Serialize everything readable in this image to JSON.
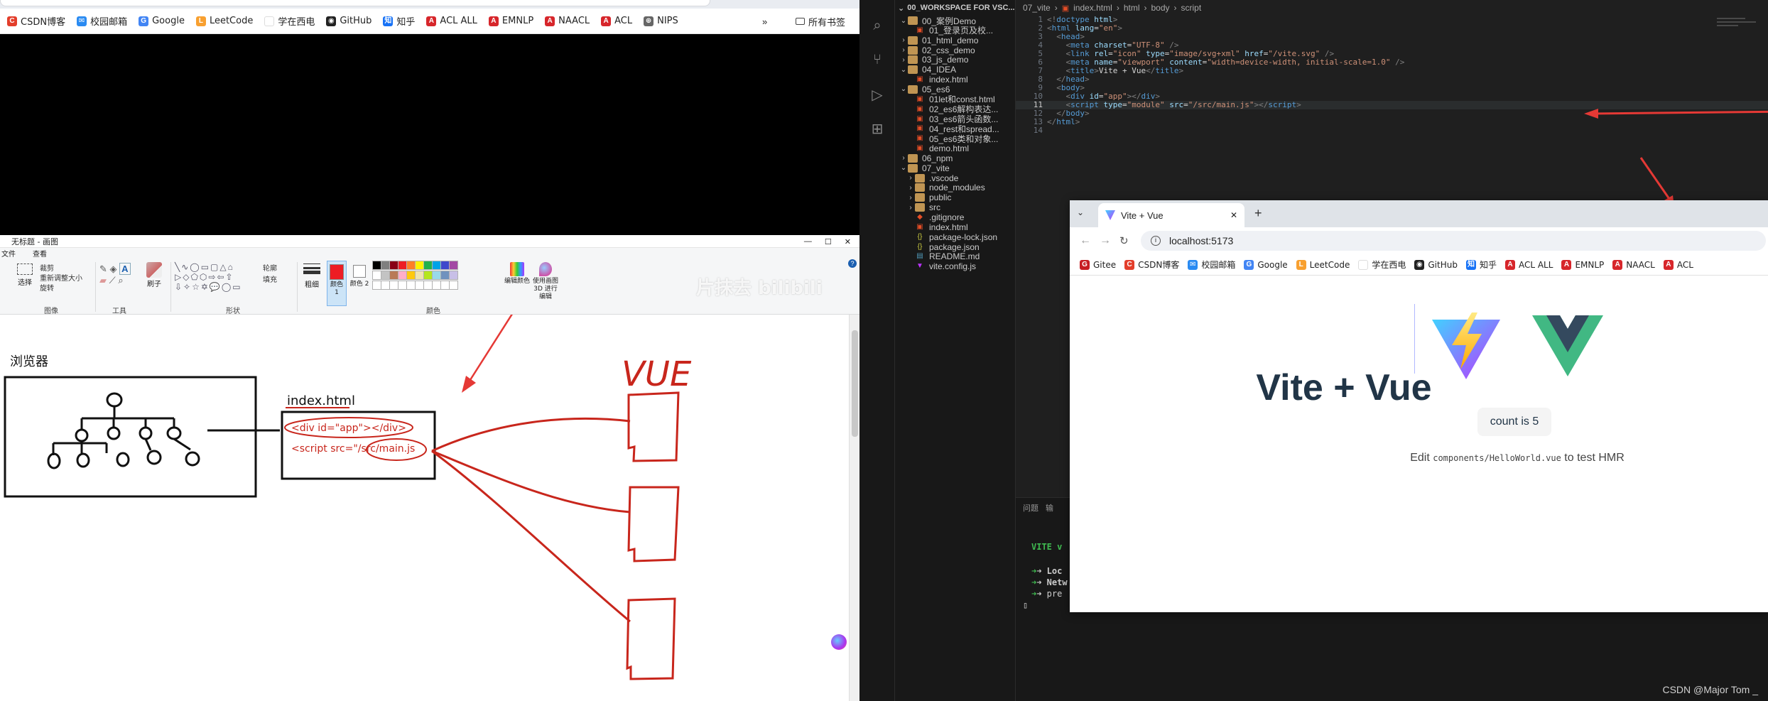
{
  "left_browser": {
    "bookmarks": [
      {
        "label": "CSDN博客",
        "color": "#e33e2b",
        "glyph": "C"
      },
      {
        "label": "校园邮箱",
        "color": "#2a8bf2",
        "glyph": "✉"
      },
      {
        "label": "Google",
        "color": "#4285f4",
        "glyph": "G"
      },
      {
        "label": "LeetCode",
        "color": "#f8a030",
        "glyph": "L"
      },
      {
        "label": "学在西电",
        "color": "#ffffff",
        "glyph": ""
      },
      {
        "label": "GitHub",
        "color": "#222222",
        "glyph": "◉"
      },
      {
        "label": "知乎",
        "color": "#1772f6",
        "glyph": "知"
      },
      {
        "label": "ACL ALL",
        "color": "#d7262b",
        "glyph": "A"
      },
      {
        "label": "EMNLP",
        "color": "#d7262b",
        "glyph": "A"
      },
      {
        "label": "NAACL",
        "color": "#d7262b",
        "glyph": "A"
      },
      {
        "label": "ACL",
        "color": "#d7262b",
        "glyph": "A"
      },
      {
        "label": "NIPS",
        "color": "#666666",
        "glyph": "⊕"
      }
    ],
    "more_label": "»",
    "all_bookmarks_label": "所有书签"
  },
  "paint": {
    "title": "无标题 - 画图",
    "tabs": [
      "文件",
      "查看"
    ],
    "groups": [
      "图像",
      "工具",
      "形状",
      "颜色"
    ],
    "image_tools": [
      "裁剪",
      "重新调整大小",
      "旋转"
    ],
    "select_label": "选择",
    "brush_label": "刷子",
    "outline_label": "轮廓",
    "fill_label": "填充",
    "size_label": "粗细",
    "color1_label": "颜色 1",
    "color2_label": "颜色 2",
    "edit_colors_label": "编辑颜色",
    "paint3d_label": "使用画图 3D 进行编辑",
    "palette": [
      "#000000",
      "#7f7f7f",
      "#880015",
      "#ed1c24",
      "#ff7f27",
      "#fff200",
      "#22b14c",
      "#00a2e8",
      "#3f48cc",
      "#a349a4",
      "#ffffff",
      "#c3c3c3",
      "#b97a57",
      "#ffaec9",
      "#ffc90e",
      "#efe4b0",
      "#b5e61d",
      "#99d9ea",
      "#7092be",
      "#c8bfe7"
    ],
    "active_color": "#ed1c24",
    "overlay_watermark": "片抹去 bilibili",
    "canvas": {
      "browser_label": "浏览器",
      "file_label": "index.html",
      "line1": "<div id=\"app\"></div>",
      "line2": "<script src=\"/src/main.js",
      "vue_label": "VUE",
      "ink_color": "#c8261c"
    }
  },
  "vscode": {
    "explorer_title": "00_WORKSPACE FOR VSC...",
    "tree": [
      {
        "label": "00_案例Demo",
        "type": "folder",
        "open": true,
        "depth": 0
      },
      {
        "label": "01_登录页及校...",
        "type": "html",
        "depth": 1
      },
      {
        "label": "01_html_demo",
        "type": "folder",
        "open": false,
        "depth": 0
      },
      {
        "label": "02_css_demo",
        "type": "folder",
        "open": false,
        "depth": 0
      },
      {
        "label": "03_js_demo",
        "type": "folder",
        "open": false,
        "depth": 0
      },
      {
        "label": "04_IDEA",
        "type": "folder",
        "open": true,
        "depth": 0
      },
      {
        "label": "index.html",
        "type": "html",
        "depth": 1
      },
      {
        "label": "05_es6",
        "type": "folder",
        "open": true,
        "depth": 0
      },
      {
        "label": "01let和const.html",
        "type": "html",
        "depth": 1
      },
      {
        "label": "02_es6解构表达...",
        "type": "html",
        "depth": 1
      },
      {
        "label": "03_es6箭头函数...",
        "type": "html",
        "depth": 1
      },
      {
        "label": "04_rest和spread...",
        "type": "html",
        "depth": 1
      },
      {
        "label": "05_es6类和对象...",
        "type": "html",
        "depth": 1
      },
      {
        "label": "demo.html",
        "type": "html",
        "depth": 1
      },
      {
        "label": "06_npm",
        "type": "folder",
        "open": false,
        "depth": 0
      },
      {
        "label": "07_vite",
        "type": "folder",
        "open": true,
        "depth": 0
      },
      {
        "label": ".vscode",
        "type": "folder",
        "open": false,
        "depth": 1
      },
      {
        "label": "node_modules",
        "type": "folder",
        "open": false,
        "depth": 1
      },
      {
        "label": "public",
        "type": "folder",
        "open": false,
        "depth": 1
      },
      {
        "label": "src",
        "type": "folder",
        "open": false,
        "depth": 1
      },
      {
        "label": ".gitignore",
        "type": "git",
        "depth": 1
      },
      {
        "label": "index.html",
        "type": "html",
        "depth": 1
      },
      {
        "label": "package-lock.json",
        "type": "json",
        "depth": 1
      },
      {
        "label": "package.json",
        "type": "json",
        "depth": 1
      },
      {
        "label": "README.md",
        "type": "md",
        "depth": 1
      },
      {
        "label": "vite.config.js",
        "type": "vite",
        "depth": 1
      }
    ],
    "breadcrumbs": [
      "07_vite",
      "index.html",
      "html",
      "body",
      "script"
    ],
    "code_lines": [
      {
        "n": "1",
        "tokens": [
          [
            "t-punc",
            "<!"
          ],
          [
            "t-tag",
            "doctype"
          ],
          [
            "t-text",
            " "
          ],
          [
            "t-attr",
            "html"
          ],
          [
            "t-punc",
            ">"
          ]
        ]
      },
      {
        "n": "2",
        "tokens": [
          [
            "t-punc",
            "<"
          ],
          [
            "t-tag",
            "html"
          ],
          [
            "t-text",
            " "
          ],
          [
            "t-attr",
            "lang"
          ],
          [
            "t-text",
            "="
          ],
          [
            "t-str",
            "\"en\""
          ],
          [
            "t-punc",
            ">"
          ]
        ]
      },
      {
        "n": "3",
        "tokens": [
          [
            "t-text",
            "  "
          ],
          [
            "t-punc",
            "<"
          ],
          [
            "t-tag",
            "head"
          ],
          [
            "t-punc",
            ">"
          ]
        ]
      },
      {
        "n": "4",
        "tokens": [
          [
            "t-text",
            "    "
          ],
          [
            "t-punc",
            "<"
          ],
          [
            "t-tag",
            "meta"
          ],
          [
            "t-text",
            " "
          ],
          [
            "t-attr",
            "charset"
          ],
          [
            "t-text",
            "="
          ],
          [
            "t-str",
            "\"UTF-8\""
          ],
          [
            "t-text",
            " "
          ],
          [
            "t-punc",
            "/>"
          ]
        ]
      },
      {
        "n": "5",
        "tokens": [
          [
            "t-text",
            "    "
          ],
          [
            "t-punc",
            "<"
          ],
          [
            "t-tag",
            "link"
          ],
          [
            "t-text",
            " "
          ],
          [
            "t-attr",
            "rel"
          ],
          [
            "t-text",
            "="
          ],
          [
            "t-str",
            "\"icon\""
          ],
          [
            "t-text",
            " "
          ],
          [
            "t-attr",
            "type"
          ],
          [
            "t-text",
            "="
          ],
          [
            "t-str",
            "\"image/svg+xml\""
          ],
          [
            "t-text",
            " "
          ],
          [
            "t-attr",
            "href"
          ],
          [
            "t-text",
            "="
          ],
          [
            "t-str",
            "\"/vite.svg\""
          ],
          [
            "t-text",
            " "
          ],
          [
            "t-punc",
            "/>"
          ]
        ]
      },
      {
        "n": "6",
        "tokens": [
          [
            "t-text",
            "    "
          ],
          [
            "t-punc",
            "<"
          ],
          [
            "t-tag",
            "meta"
          ],
          [
            "t-text",
            " "
          ],
          [
            "t-attr",
            "name"
          ],
          [
            "t-text",
            "="
          ],
          [
            "t-str",
            "\"viewport\""
          ],
          [
            "t-text",
            " "
          ],
          [
            "t-attr",
            "content"
          ],
          [
            "t-text",
            "="
          ],
          [
            "t-str",
            "\"width=device-width, initial-scale=1.0\""
          ],
          [
            "t-text",
            " "
          ],
          [
            "t-punc",
            "/>"
          ]
        ]
      },
      {
        "n": "7",
        "tokens": [
          [
            "t-text",
            "    "
          ],
          [
            "t-punc",
            "<"
          ],
          [
            "t-tag",
            "title"
          ],
          [
            "t-punc",
            ">"
          ],
          [
            "t-text",
            "Vite + Vue"
          ],
          [
            "t-punc",
            "</"
          ],
          [
            "t-tag",
            "title"
          ],
          [
            "t-punc",
            ">"
          ]
        ]
      },
      {
        "n": "8",
        "tokens": [
          [
            "t-text",
            "  "
          ],
          [
            "t-punc",
            "</"
          ],
          [
            "t-tag",
            "head"
          ],
          [
            "t-punc",
            ">"
          ]
        ]
      },
      {
        "n": "9",
        "tokens": [
          [
            "t-text",
            "  "
          ],
          [
            "t-punc",
            "<"
          ],
          [
            "t-tag",
            "body"
          ],
          [
            "t-punc",
            ">"
          ]
        ]
      },
      {
        "n": "10",
        "tokens": [
          [
            "t-text",
            "    "
          ],
          [
            "t-punc",
            "<"
          ],
          [
            "t-tag",
            "div"
          ],
          [
            "t-text",
            " "
          ],
          [
            "t-attr",
            "id"
          ],
          [
            "t-text",
            "="
          ],
          [
            "t-str",
            "\"app\""
          ],
          [
            "t-punc",
            "></"
          ],
          [
            "t-tag",
            "div"
          ],
          [
            "t-punc",
            ">"
          ]
        ]
      },
      {
        "n": "11",
        "tokens": [
          [
            "t-text",
            "    "
          ],
          [
            "t-punc",
            "<"
          ],
          [
            "t-tag",
            "script"
          ],
          [
            "t-text",
            " "
          ],
          [
            "t-attr",
            "type"
          ],
          [
            "t-text",
            "="
          ],
          [
            "t-str",
            "\"module\""
          ],
          [
            "t-text",
            " "
          ],
          [
            "t-attr",
            "src"
          ],
          [
            "t-text",
            "="
          ],
          [
            "t-str",
            "\"/src/main.js\""
          ],
          [
            "t-punc",
            "></"
          ],
          [
            "t-tag",
            "script"
          ],
          [
            "t-punc",
            ">"
          ]
        ]
      },
      {
        "n": "12",
        "tokens": [
          [
            "t-text",
            "  "
          ],
          [
            "t-punc",
            "</"
          ],
          [
            "t-tag",
            "body"
          ],
          [
            "t-punc",
            ">"
          ]
        ]
      },
      {
        "n": "13",
        "tokens": [
          [
            "t-punc",
            "</"
          ],
          [
            "t-tag",
            "html"
          ],
          [
            "t-punc",
            ">"
          ]
        ]
      },
      {
        "n": "14",
        "tokens": []
      }
    ],
    "active_line": "11",
    "terminal": {
      "tabs": [
        "问题",
        "输"
      ],
      "lines": [
        "VITE v",
        "➜  Loc",
        "➜  Netw",
        "➜  pre"
      ],
      "cursor": "▯"
    },
    "watermark": "CSDN @Major Tom _"
  },
  "chrome": {
    "tab_title": "Vite + Vue",
    "new_tab_label": "+",
    "url": "localhost:5173",
    "bookmarks": [
      {
        "label": "Gitee",
        "color": "#c71d23",
        "glyph": "G"
      },
      {
        "label": "CSDN博客",
        "color": "#e33e2b",
        "glyph": "C"
      },
      {
        "label": "校园邮箱",
        "color": "#2a8bf2",
        "glyph": "✉"
      },
      {
        "label": "Google",
        "color": "#4285f4",
        "glyph": "G"
      },
      {
        "label": "LeetCode",
        "color": "#f8a030",
        "glyph": "L"
      },
      {
        "label": "学在西电",
        "color": "#ffffff",
        "glyph": ""
      },
      {
        "label": "GitHub",
        "color": "#222222",
        "glyph": "◉"
      },
      {
        "label": "知乎",
        "color": "#1772f6",
        "glyph": "知"
      },
      {
        "label": "ACL ALL",
        "color": "#d7262b",
        "glyph": "A"
      },
      {
        "label": "EMNLP",
        "color": "#d7262b",
        "glyph": "A"
      },
      {
        "label": "NAACL",
        "color": "#d7262b",
        "glyph": "A"
      },
      {
        "label": "ACL",
        "color": "#d7262b",
        "glyph": "A"
      }
    ],
    "page": {
      "heading": "Vite + Vue",
      "count_label": "count is 5",
      "edit_prefix": "Edit ",
      "edit_code": "components/HelloWorld.vue",
      "edit_suffix": " to test HMR"
    }
  }
}
